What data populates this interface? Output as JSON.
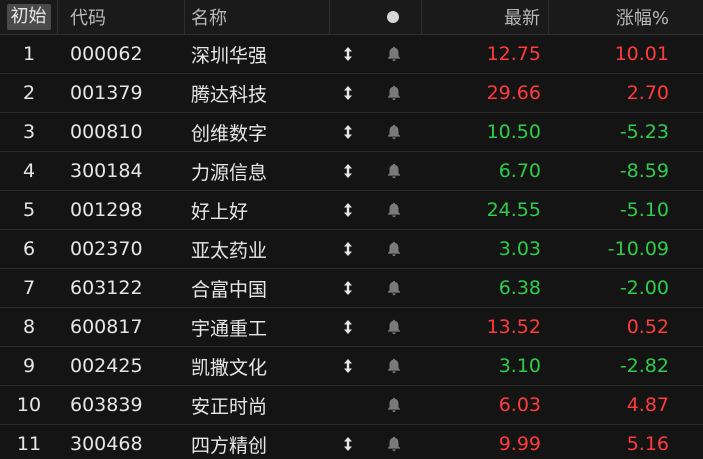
{
  "header": {
    "reset_label": "初始",
    "code_label": "代码",
    "name_label": "名称",
    "price_label": "最新",
    "change_label": "涨幅%"
  },
  "colors": {
    "up": "#ff3b3b",
    "down": "#2ecc4a",
    "text": "#e6e6e6",
    "background": "#141414"
  },
  "rows": [
    {
      "index": "1",
      "code": "000062",
      "name": "深圳华强",
      "price": "12.75",
      "change": "10.01",
      "direction": "up",
      "has_arrow": true
    },
    {
      "index": "2",
      "code": "001379",
      "name": "腾达科技",
      "price": "29.66",
      "change": "2.70",
      "direction": "up",
      "has_arrow": true
    },
    {
      "index": "3",
      "code": "000810",
      "name": "创维数字",
      "price": "10.50",
      "change": "-5.23",
      "direction": "down",
      "has_arrow": true
    },
    {
      "index": "4",
      "code": "300184",
      "name": "力源信息",
      "price": "6.70",
      "change": "-8.59",
      "direction": "down",
      "has_arrow": true
    },
    {
      "index": "5",
      "code": "001298",
      "name": "好上好",
      "price": "24.55",
      "change": "-5.10",
      "direction": "down",
      "has_arrow": true
    },
    {
      "index": "6",
      "code": "002370",
      "name": "亚太药业",
      "price": "3.03",
      "change": "-10.09",
      "direction": "down",
      "has_arrow": true
    },
    {
      "index": "7",
      "code": "603122",
      "name": "合富中国",
      "price": "6.38",
      "change": "-2.00",
      "direction": "down",
      "has_arrow": true
    },
    {
      "index": "8",
      "code": "600817",
      "name": "宇通重工",
      "price": "13.52",
      "change": "0.52",
      "direction": "up",
      "has_arrow": true
    },
    {
      "index": "9",
      "code": "002425",
      "name": "凯撒文化",
      "price": "3.10",
      "change": "-2.82",
      "direction": "down",
      "has_arrow": true
    },
    {
      "index": "10",
      "code": "603839",
      "name": "安正时尚",
      "price": "6.03",
      "change": "4.87",
      "direction": "up",
      "has_arrow": false
    },
    {
      "index": "11",
      "code": "300468",
      "name": "四方精创",
      "price": "9.99",
      "change": "5.16",
      "direction": "up",
      "has_arrow": true
    }
  ]
}
